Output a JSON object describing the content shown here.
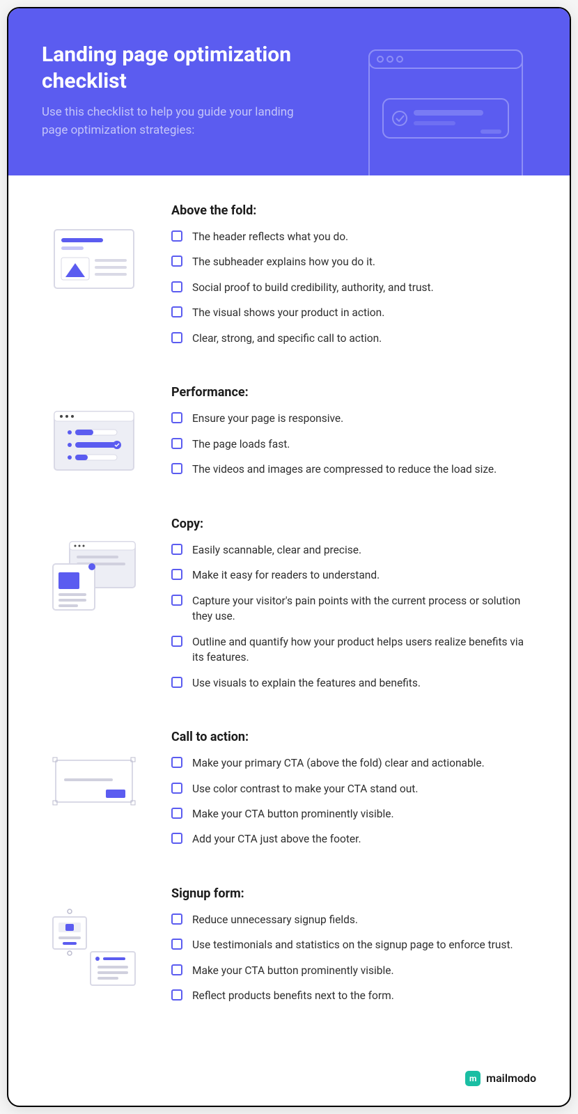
{
  "header": {
    "title": "Landing page optimization checklist",
    "subtitle": "Use this checklist to help you guide your landing page optimization strategies:"
  },
  "sections": [
    {
      "title": "Above the fold:",
      "items": [
        "The header reflects what you do.",
        "The subheader explains how you do it.",
        "Social proof to build credibility, authority, and trust.",
        "The visual shows your product in action.",
        "Clear, strong, and specific call to action."
      ]
    },
    {
      "title": "Performance:",
      "items": [
        "Ensure your page is responsive.",
        "The page loads fast.",
        "The videos and images are compressed to reduce the load size."
      ]
    },
    {
      "title": "Copy:",
      "items": [
        "Easily scannable, clear and precise.",
        "Make it easy for readers to understand.",
        "Capture your visitor's pain points with the current process or solution they use.",
        "Outline and quantify how your product helps users realize benefits via its features.",
        "Use visuals to explain the features and benefits."
      ]
    },
    {
      "title": "Call to action:",
      "items": [
        "Make your primary CTA (above the fold) clear and actionable.",
        "Use color contrast to make your CTA stand out.",
        "Make your CTA button prominently visible.",
        "Add your CTA just above the footer."
      ]
    },
    {
      "title": "Signup form:",
      "items": [
        "Reduce unnecessary signup fields.",
        "Use testimonials and statistics on the signup page to enforce trust.",
        "Make your CTA button prominently visible.",
        "Reflect products benefits next to the form."
      ]
    }
  ],
  "footer": {
    "brand": "mailmodo",
    "logo_letter": "m"
  }
}
